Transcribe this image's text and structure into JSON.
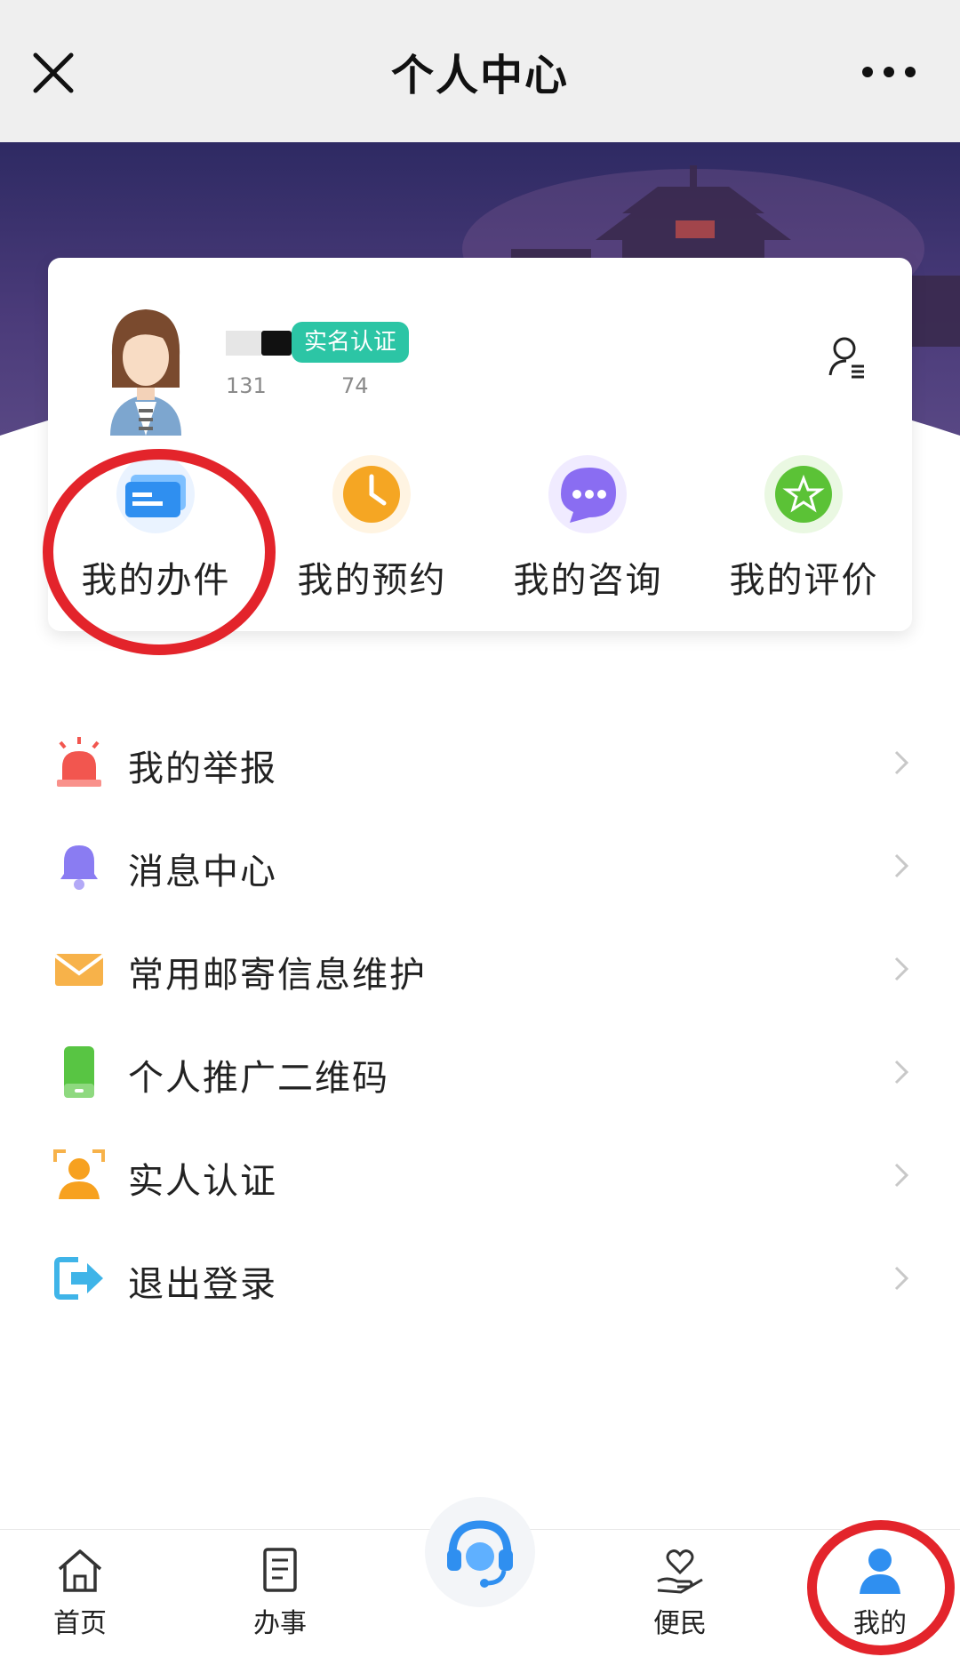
{
  "topbar": {
    "title": "个人中心",
    "close_icon": "close-icon",
    "more_icon": "more-dots-icon"
  },
  "profile": {
    "verify_badge": "实名认证",
    "stat_1": "131",
    "stat_2": "74",
    "settings_icon": "user-settings-icon"
  },
  "quick_actions": [
    {
      "label": "我的办件",
      "icon": "cards-icon",
      "color": "#2f8ff0"
    },
    {
      "label": "我的预约",
      "icon": "clock-icon",
      "color": "#f5a623"
    },
    {
      "label": "我的咨询",
      "icon": "chat-bubble-icon",
      "color": "#8a6df2"
    },
    {
      "label": "我的评价",
      "icon": "star-icon",
      "color": "#5bc236"
    }
  ],
  "menu": [
    {
      "label": "我的举报",
      "icon": "alarm-light-icon"
    },
    {
      "label": "消息中心",
      "icon": "bell-icon"
    },
    {
      "label": "常用邮寄信息维护",
      "icon": "envelope-icon"
    },
    {
      "label": "个人推广二维码",
      "icon": "phone-icon"
    },
    {
      "label": "实人认证",
      "icon": "face-scan-icon"
    },
    {
      "label": "退出登录",
      "icon": "logout-icon"
    }
  ],
  "tabbar": {
    "tabs": [
      {
        "label": "首页",
        "icon": "home-icon"
      },
      {
        "label": "办事",
        "icon": "document-icon"
      },
      {
        "label": "便民",
        "icon": "heart-hand-icon"
      },
      {
        "label": "我的",
        "icon": "person-icon"
      }
    ],
    "center_icon": "headset-service-icon",
    "active_color": "#2f8ff0"
  },
  "colors": {
    "annotation_ring": "#e3242b",
    "verify_badge": "#2cc5a5"
  }
}
